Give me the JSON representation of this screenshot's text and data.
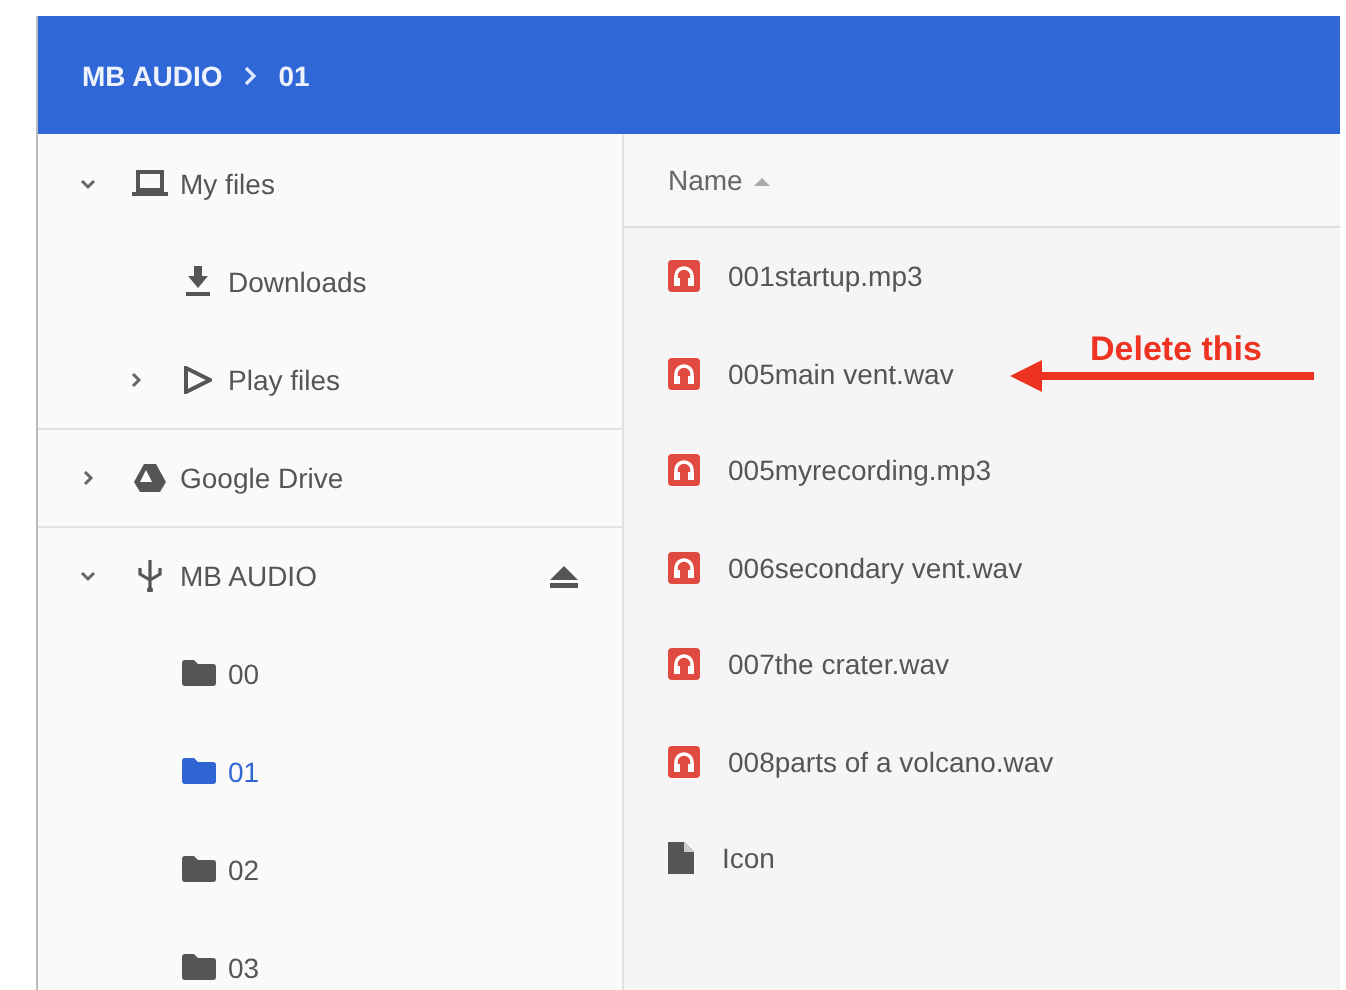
{
  "breadcrumb": [
    "MB AUDIO",
    "01"
  ],
  "sidebar": {
    "items": [
      {
        "label": "My files",
        "kind": "computer",
        "expanded": true,
        "selected": false,
        "children": [
          {
            "label": "Downloads",
            "kind": "downloads",
            "selected": false
          },
          {
            "label": "Play files",
            "kind": "play",
            "expanded": false,
            "selected": false
          }
        ]
      },
      {
        "label": "Google Drive",
        "kind": "drive",
        "expanded": false,
        "selected": false
      },
      {
        "label": "MB AUDIO",
        "kind": "usb",
        "expanded": true,
        "selected": false,
        "ejectable": true,
        "children": [
          {
            "label": "00",
            "kind": "folder",
            "selected": false
          },
          {
            "label": "01",
            "kind": "folder",
            "selected": true
          },
          {
            "label": "02",
            "kind": "folder",
            "selected": false
          },
          {
            "label": "03",
            "kind": "folder",
            "selected": false
          }
        ]
      }
    ]
  },
  "table": {
    "columns": [
      {
        "label": "Name",
        "sorted_ascending": true
      }
    ],
    "rows": [
      {
        "name": "001startup.mp3",
        "kind": "audio"
      },
      {
        "name": "005main vent.wav",
        "kind": "audio",
        "annotation": "Delete this"
      },
      {
        "name": "005myrecording.mp3",
        "kind": "audio"
      },
      {
        "name": "006secondary vent.wav",
        "kind": "audio"
      },
      {
        "name": "007the crater.wav",
        "kind": "audio"
      },
      {
        "name": "008parts of a volcano.wav",
        "kind": "audio"
      },
      {
        "name": "Icon",
        "kind": "file"
      }
    ]
  }
}
